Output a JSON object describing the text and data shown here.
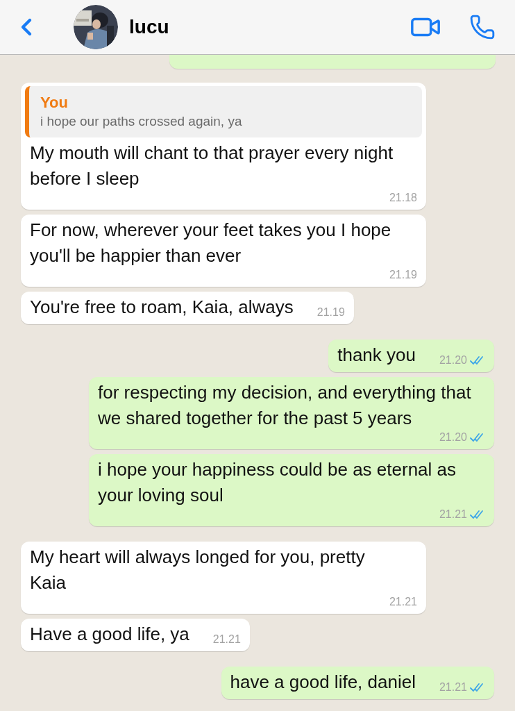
{
  "header": {
    "contact_name": "lucu"
  },
  "messages": [
    {
      "kind": "incoming",
      "reply": {
        "author": "You",
        "text": "i hope our paths crossed again, ya"
      },
      "text": "My mouth will chant to that prayer every night before I sleep",
      "time": "21.18"
    },
    {
      "kind": "incoming",
      "text": "For now, wherever your feet takes you I hope you'll be happier than ever",
      "time": "21.19"
    },
    {
      "kind": "incoming",
      "text": "You're free to roam, Kaia, always",
      "time": "21.19"
    },
    {
      "kind": "outgoing",
      "text": "thank you",
      "time": "21.20",
      "read": true
    },
    {
      "kind": "outgoing",
      "text": "for respecting my decision, and everything that we shared together for the past 5 years",
      "time": "21.20",
      "read": true
    },
    {
      "kind": "outgoing",
      "text": "i hope your happiness could be as eternal as your loving soul",
      "time": "21.21",
      "read": true
    },
    {
      "kind": "incoming",
      "text": "My heart will always longed for you, pretty Kaia",
      "time": "21.21"
    },
    {
      "kind": "incoming",
      "text": "Have a good life, ya",
      "time": "21.21"
    },
    {
      "kind": "outgoing",
      "text": "have a good life, daniel",
      "time": "21.21",
      "read": true
    }
  ]
}
